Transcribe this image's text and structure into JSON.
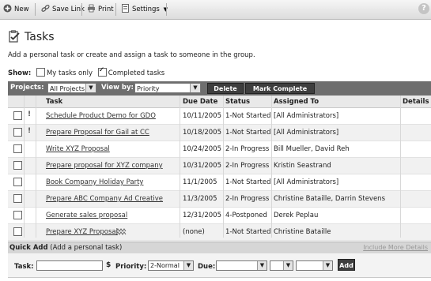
{
  "toolbar": {
    "new_label": "New",
    "save_link_label": "Save Link",
    "print_label": "Print",
    "settings_label": "Settings",
    "help_label": "?"
  },
  "page": {
    "title": "Tasks",
    "intro": "Add a personal task or create and assign a task to someone in the group."
  },
  "show": {
    "label": "Show:",
    "my_tasks_label": "My tasks only",
    "my_tasks_checked": false,
    "completed_label": "Completed tasks",
    "completed_checked": true
  },
  "filter": {
    "projects_label": "Projects:",
    "projects_value": "All Projects",
    "view_by_label": "View by:",
    "view_by_value": "Priority",
    "delete_label": "Delete",
    "mark_complete_label": "Mark Complete"
  },
  "table": {
    "headers": {
      "task": "Task",
      "due": "Due Date",
      "status": "Status",
      "assigned": "Assigned To",
      "details": "Details"
    },
    "rows": [
      {
        "priority": "!",
        "task": "Schedule Product Demo for GDO",
        "due": "10/11/2005",
        "status": "1-Not Started",
        "assigned": "[All Administrators]"
      },
      {
        "priority": "!",
        "task": "Prepare Proposal for Gail at CC",
        "due": "10/18/2005",
        "status": "1-Not Started",
        "assigned": "[All Administrators]"
      },
      {
        "priority": "",
        "task": "Write XYZ Proposal",
        "due": "10/24/2005",
        "status": "2-In Progress",
        "assigned": "Bill Mueller, David Reh"
      },
      {
        "priority": "",
        "task": "Prepare proposal for XYZ company",
        "due": "10/31/2005",
        "status": "2-In Progress",
        "assigned": "Kristin Seastrand"
      },
      {
        "priority": "",
        "task": "Book Company Holiday Party",
        "due": "11/1/2005",
        "status": "1-Not Started",
        "assigned": "[All Administrators]"
      },
      {
        "priority": "",
        "task": "Prepare ABC Company Ad Creative",
        "due": "11/3/2005",
        "status": "2-In Progress",
        "assigned": "Christine Bataille, Darrin Stevens"
      },
      {
        "priority": "",
        "task": "Generate sales proposal",
        "due": "12/31/2005",
        "status": "4-Postponed",
        "assigned": "Derek Peplau"
      },
      {
        "priority": "",
        "task": "Prepare XYZ Proposal",
        "due": "(none)",
        "status": "1-Not Started",
        "assigned": "Christine Bataille"
      }
    ]
  },
  "quick_add": {
    "title": "Quick Add",
    "subtitle": "(Add a personal task)",
    "more_link": "Include More Details",
    "task_label": "Task:",
    "priority_label": "Priority:",
    "priority_value": "2-Normal",
    "due_label": "Due:",
    "add_label": "Add"
  }
}
